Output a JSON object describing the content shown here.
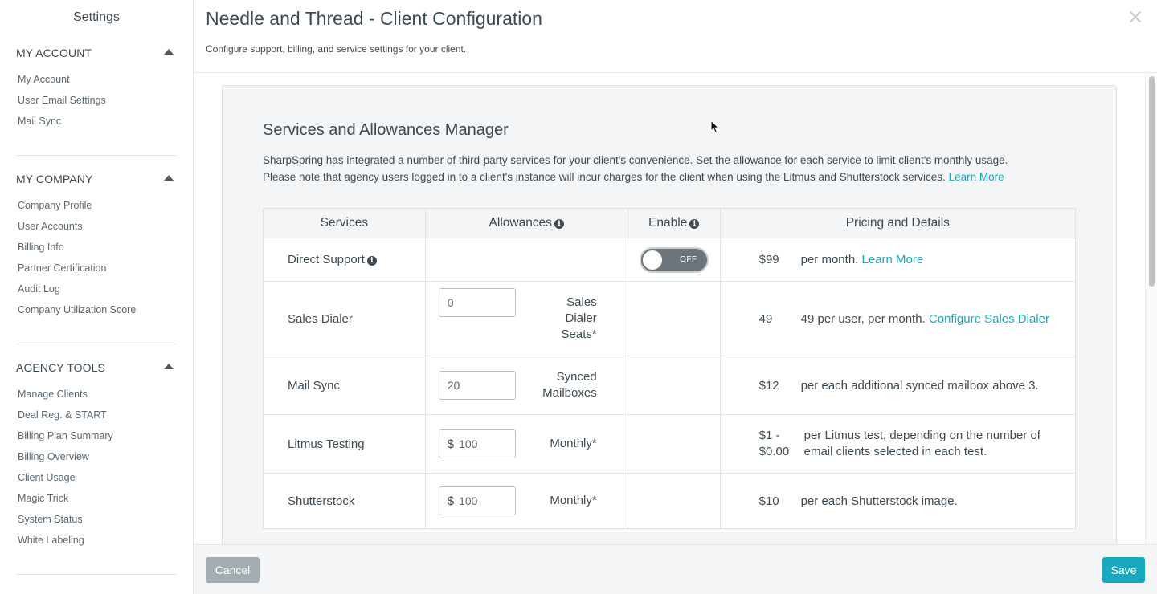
{
  "sidebar": {
    "title": "Settings",
    "sections": [
      {
        "header": "MY ACCOUNT",
        "items": [
          "My Account",
          "User Email Settings",
          "Mail Sync"
        ]
      },
      {
        "header": "MY COMPANY",
        "items": [
          "Company Profile",
          "User Accounts",
          "Billing Info",
          "Partner Certification",
          "Audit Log",
          "Company Utilization Score"
        ]
      },
      {
        "header": "AGENCY TOOLS",
        "items": [
          "Manage Clients",
          "Deal Reg. & START",
          "Billing Plan Summary",
          "Billing Overview",
          "Client Usage",
          "Magic Trick",
          "System Status",
          "White Labeling"
        ]
      }
    ]
  },
  "header": {
    "title": "Needle and Thread - Client Configuration",
    "subtitle": "Configure support, billing, and service settings for your client.",
    "close_icon": "×"
  },
  "panel": {
    "title": "Services and Allowances Manager",
    "desc_line1": "SharpSpring has integrated a number of third-party services for your client's convenience. Set the allowance for each service to limit client's monthly usage.",
    "desc_line2": "Please note that agency users logged in to a client's instance will incur charges for the client when using the Litmus and Shutterstock services.",
    "learn_more": "Learn More"
  },
  "table": {
    "headers": {
      "services": "Services",
      "allowances": "Allowances",
      "enable": "Enable",
      "pricing": "Pricing and Details"
    },
    "info_glyph": "i",
    "rows": {
      "direct_support": {
        "service": "Direct Support",
        "toggle_state": "OFF",
        "price": "$99",
        "details": "per month.",
        "link": "Learn More"
      },
      "sales_dialer": {
        "service": "Sales Dialer",
        "value": "0",
        "label": "Sales Dialer Seats*",
        "price": "49",
        "details": "49 per user, per month.",
        "link": "Configure Sales Dialer"
      },
      "mail_sync": {
        "service": "Mail Sync",
        "value": "20",
        "label": "Synced Mailboxes",
        "price": "$12",
        "details": "per each additional synced mailbox above 3."
      },
      "litmus": {
        "service": "Litmus Testing",
        "currency": "$",
        "value": "100",
        "label": "Monthly*",
        "price": "$1 - $0.00",
        "details": "per Litmus test, depending on the number of email clients selected in each test."
      },
      "shutterstock": {
        "service": "Shutterstock",
        "currency": "$",
        "value": "100",
        "label": "Monthly*",
        "price": "$10",
        "details": "per each Shutterstock image."
      }
    }
  },
  "footer": {
    "cancel": "Cancel",
    "save": "Save"
  }
}
